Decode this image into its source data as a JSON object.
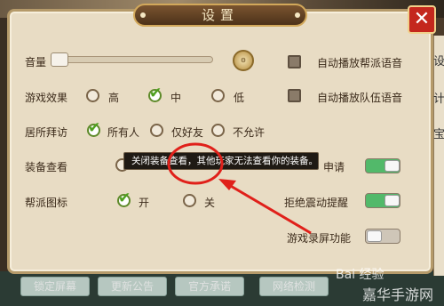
{
  "dialog": {
    "title": "设置",
    "close_label": "✕"
  },
  "settings": {
    "volume": {
      "label": "音量",
      "level": 0.03
    },
    "game_effect": {
      "label": "游戏效果",
      "options": [
        "高",
        "中",
        "低"
      ],
      "selected": "中"
    },
    "residence_visit": {
      "label": "居所拜访",
      "options": [
        "所有人",
        "仅好友",
        "不允许"
      ],
      "selected": "所有人"
    },
    "equipment_view": {
      "label": "装备查看"
    },
    "guild_icon": {
      "label": "帮派图标",
      "options": [
        "开",
        "关"
      ],
      "selected": "开"
    },
    "auto_guild_voice": {
      "label": "自动播放帮派语音",
      "checked": false
    },
    "auto_team_voice": {
      "label": "自动播放队伍语音",
      "checked": false
    },
    "request_partial": {
      "label": "申请",
      "on": true
    },
    "refuse_vibration": {
      "label": "拒绝震动提醒",
      "on": true
    },
    "screen_record": {
      "label": "游戏录屏功能",
      "on": false
    }
  },
  "tooltip": {
    "text": "关闭装备查看，其他玩家无法查看你的装备。"
  },
  "bottom_buttons": [
    "锁定屏幕",
    "更新公告",
    "官方承诺",
    "网络检测"
  ],
  "side_panel_chars": [
    "设",
    "计",
    "宝"
  ],
  "watermarks": {
    "baidu": "Bai 经验",
    "site": "嘉华手游网"
  },
  "colors": {
    "panel_bg": "#e8dcc4",
    "accent_green": "#52b96a",
    "close_red": "#c4271d",
    "annotation_red": "#e0201a"
  }
}
